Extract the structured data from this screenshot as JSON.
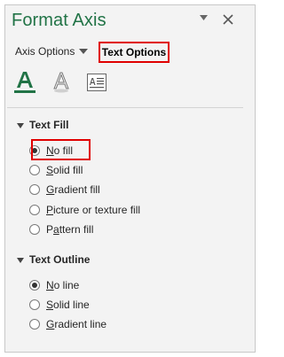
{
  "pane": {
    "title": "Format Axis",
    "options_arrow_icon": "dropdown-triangle-icon",
    "close_icon": "close-x-icon"
  },
  "tabs": [
    {
      "label": "Axis Options",
      "selected": false,
      "icon": "dropdown-triangle-icon"
    },
    {
      "label": "Text Options",
      "selected": true
    }
  ],
  "category_icons": [
    "text-fill-outline-icon",
    "text-effects-icon",
    "textbox-icon"
  ],
  "sections": {
    "text_fill": {
      "label": "Text Fill",
      "expanded": true,
      "options": [
        {
          "label": "No fill",
          "hotkey_char": "N",
          "rest": "o fill",
          "selected": true
        },
        {
          "label": "Solid fill",
          "hotkey_char": "S",
          "rest": "olid fill",
          "selected": false
        },
        {
          "label": "Gradient fill",
          "hotkey_char": "G",
          "rest": "radient fill",
          "selected": false
        },
        {
          "label": "Picture or texture fill",
          "hotkey_char": "P",
          "rest": "icture or texture fill",
          "selected": false
        },
        {
          "label": "Pattern fill",
          "hotkey_char": "A",
          "rest": "",
          "selected": false
        }
      ]
    },
    "text_outline": {
      "label": "Text Outline",
      "expanded": true,
      "options": [
        {
          "label": "No line",
          "hotkey_char": "N",
          "rest": "o line",
          "selected": true
        },
        {
          "label": "Solid line",
          "hotkey_char": "S",
          "rest": "olid line",
          "selected": false
        },
        {
          "label": "Gradient line",
          "hotkey_char": "G",
          "rest": "radient line",
          "selected": false
        }
      ]
    }
  },
  "colors": {
    "accent_green": "#217346",
    "highlight_red": "#e00000",
    "pane_bg": "#f3f3f3"
  }
}
